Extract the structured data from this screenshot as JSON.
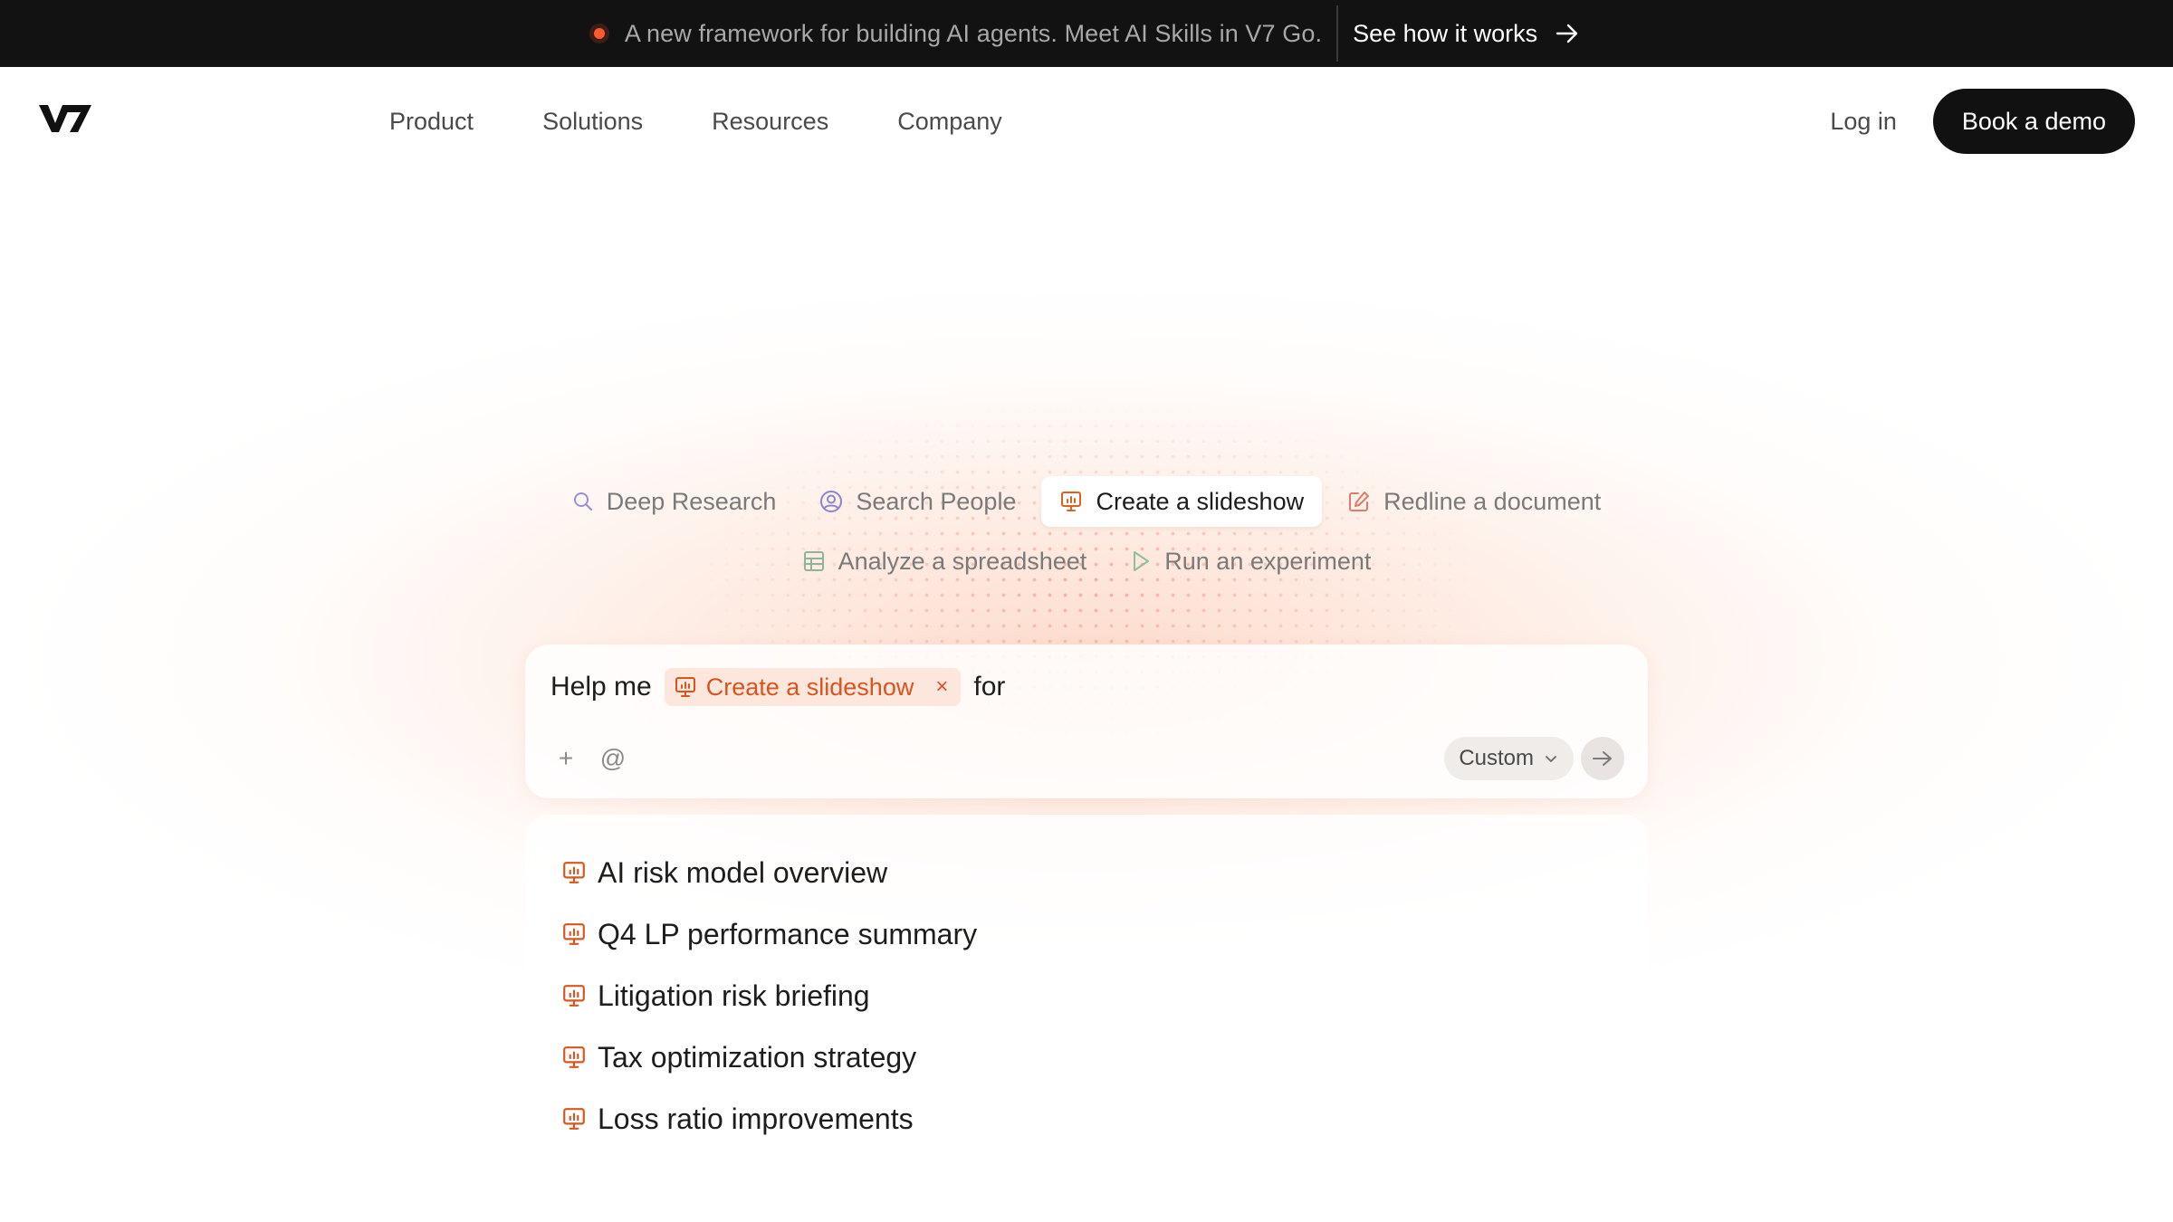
{
  "banner": {
    "text": "A new framework for building AI agents. Meet AI Skills in V7 Go.",
    "link_label": "See how it works",
    "dot_color": "#ff5a2e"
  },
  "nav": {
    "logo": "V7",
    "links": [
      "Product",
      "Solutions",
      "Resources",
      "Company"
    ],
    "login_label": "Log in",
    "demo_label": "Book a demo"
  },
  "chips": [
    {
      "label": "Deep Research",
      "icon": "search-icon",
      "color": "#9b8fd6"
    },
    {
      "label": "Search People",
      "icon": "user-circle-icon",
      "color": "#8a86c9"
    },
    {
      "label": "Create a slideshow",
      "icon": "presentation-icon",
      "color": "#e0601f",
      "active": true
    },
    {
      "label": "Redline a document",
      "icon": "edit-icon",
      "color": "#e07a6a"
    },
    {
      "label": "Analyze a spreadsheet",
      "icon": "table-icon",
      "color": "#8fb39a"
    },
    {
      "label": "Run an experiment",
      "icon": "play-icon",
      "color": "#8fbf97"
    }
  ],
  "prompt": {
    "prefix": "Help me",
    "skill": "Create a slideshow",
    "suffix": "for",
    "remove_glyph": "×",
    "add_glyph": "+",
    "mention_glyph": "@",
    "model_label": "Custom",
    "accent": "#d9551e"
  },
  "suggestions": [
    "AI risk model overview",
    "Q4 LP performance summary",
    "Litigation risk briefing",
    "Tax optimization strategy",
    "Loss ratio improvements"
  ]
}
